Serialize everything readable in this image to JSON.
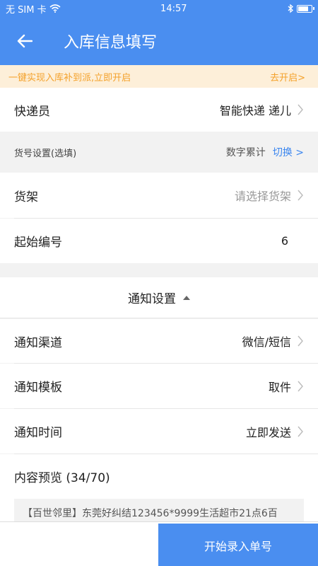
{
  "status_bar": {
    "carrier": "无 SIM 卡",
    "time": "14:57",
    "battery_level": 0.85
  },
  "header": {
    "title": "入库信息填写"
  },
  "promo": {
    "text": "一键实现入库补到派,立即开启",
    "link": "去开启>"
  },
  "courier": {
    "label": "快递员",
    "value": "智能快递 递儿"
  },
  "cargo_setting": {
    "label": "货号设置(选填)",
    "mode": "数字累计",
    "switch_label": "切换 >"
  },
  "shelf": {
    "label": "货架",
    "placeholder": "请选择货架"
  },
  "start_number": {
    "label": "起始编号",
    "value": "6"
  },
  "notify": {
    "section_title": "通知设置",
    "channel": {
      "label": "通知渠道",
      "value": "微信/短信"
    },
    "template": {
      "label": "通知模板",
      "value": "取件"
    },
    "time": {
      "label": "通知时间",
      "value": "立即发送"
    }
  },
  "preview": {
    "label": "内容预览 (34/70)",
    "text": "【百世邻里】东莞好纠结123456*9999生活超市21点6百"
  },
  "actions": {
    "start_label": "开始录入单号"
  },
  "colors": {
    "brand": "#4a8ef0",
    "promo_bg": "#fdefd9",
    "promo_text": "#f4a12a",
    "link": "#3b86ef"
  }
}
